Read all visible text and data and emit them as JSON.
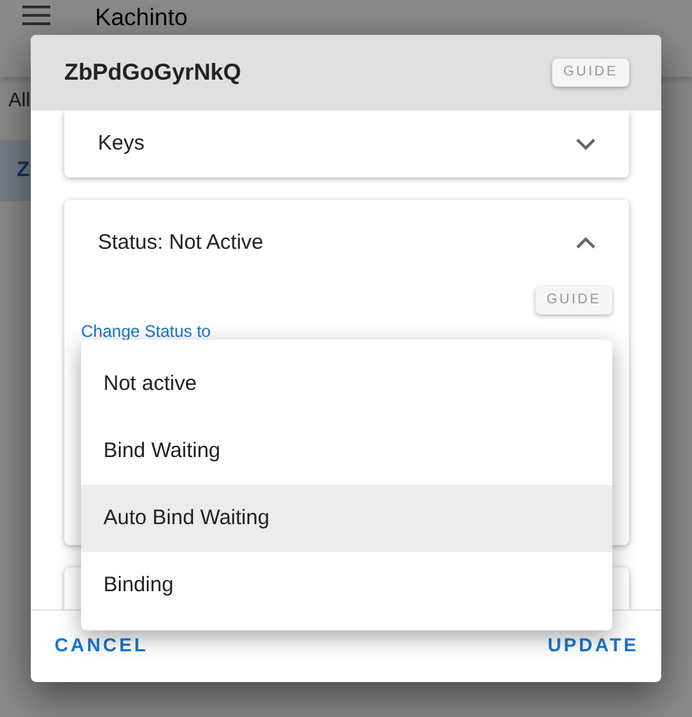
{
  "app_bar": {
    "title": "Kachinto"
  },
  "filter": {
    "label": "All"
  },
  "list": {
    "first_item": "Z"
  },
  "dialog": {
    "title": "ZbPdGoGyrNkQ",
    "guide_button": "GUIDE",
    "sections": [
      {
        "title": "Keys",
        "expanded": false
      },
      {
        "title": "Status: Not Active",
        "expanded": true,
        "guide_button": "GUIDE",
        "field_label": "Change Status to"
      }
    ],
    "menu": [
      {
        "label": "Not active",
        "highlighted": false
      },
      {
        "label": "Bind Waiting",
        "highlighted": false
      },
      {
        "label": "Auto Bind Waiting",
        "highlighted": true
      },
      {
        "label": "Binding",
        "highlighted": false
      }
    ],
    "buttons": [
      "CANCEL",
      "UPDATE"
    ]
  }
}
